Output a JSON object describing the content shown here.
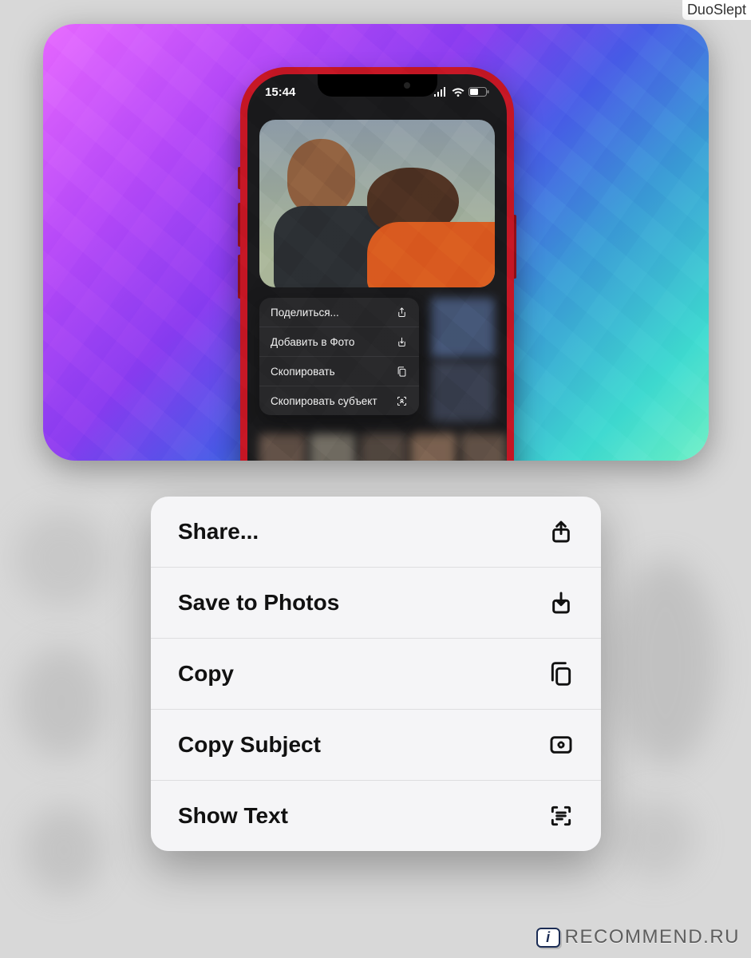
{
  "user_tag": "DuoSlept",
  "phone": {
    "time": "15:44",
    "menu": [
      {
        "label": "Поделиться...",
        "icon": "share-icon"
      },
      {
        "label": "Добавить в Фото",
        "icon": "download-icon"
      },
      {
        "label": "Скопировать",
        "icon": "copy-docs-icon"
      },
      {
        "label": "Скопировать субъект",
        "icon": "subject-icon"
      }
    ]
  },
  "context_menu": [
    {
      "label": "Share...",
      "icon": "share-icon"
    },
    {
      "label": "Save to Photos",
      "icon": "download-icon"
    },
    {
      "label": "Copy",
      "icon": "copy-docs-icon"
    },
    {
      "label": "Copy Subject",
      "icon": "subject-icon"
    },
    {
      "label": "Show Text",
      "icon": "text-scan-icon"
    }
  ],
  "watermark": {
    "badge": "i",
    "text": "RECOMMEND.RU"
  }
}
